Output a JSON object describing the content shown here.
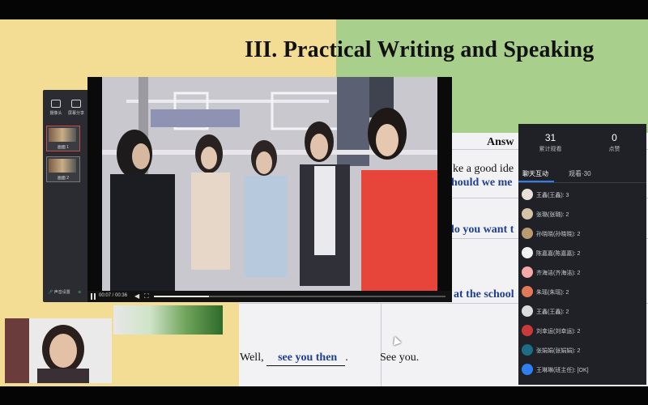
{
  "slide": {
    "title": "III. Practical Writing and Speaking",
    "header_partial": "Answ",
    "line_1": "ke a good ide",
    "answer_1": "hould we me",
    "answer_2": "lo you want t",
    "answer_3": "at the school",
    "bottom_prefix": "Well,",
    "bottom_answer": "see you then",
    "bottom_period": ".",
    "bottom_reply": "See you."
  },
  "toolbar": {
    "camera_label": "摄像头",
    "screen_share_label": "屏幕分享",
    "scene_1_label": "画面 1",
    "scene_2_label": "画面 2",
    "audio_setting_label": "声音设置"
  },
  "video": {
    "time_display": "00:07 / 00:36",
    "progress_fraction": 0.19
  },
  "panel": {
    "viewers_count": "31",
    "viewers_label": "累计观看",
    "likes_count": "0",
    "likes_label": "点赞",
    "tab_chat": "聊天互动",
    "tab_viewers": "观看·30",
    "messages": [
      {
        "text": "王鑫(王鑫): 3",
        "avatar_color": "#e9e1d8"
      },
      {
        "text": "张璐(张璐): 2",
        "avatar_color": "#d6c3a8"
      },
      {
        "text": "孙晓晓(孙晓晓): 2",
        "avatar_color": "#b99b6e"
      },
      {
        "text": "陈嘉嘉(陈嘉嘉): 2",
        "avatar_color": "#f2f2f2"
      },
      {
        "text": "齐海洁(齐海洁): 2",
        "avatar_color": "#f5a9a9"
      },
      {
        "text": "朱瑶(朱瑶): 2",
        "avatar_color": "#e27a5a"
      },
      {
        "text": "王鑫(王鑫): 2",
        "avatar_color": "#dcdcdc"
      },
      {
        "text": "刘幸运(刘幸运): 2",
        "avatar_color": "#c93a3a"
      },
      {
        "text": "张娟娟(张娟娟): 2",
        "avatar_color": "#1e6d86"
      },
      {
        "text": "王琳琳(班主任): [OK]",
        "avatar_color": "#2f7ff0"
      }
    ]
  },
  "colors": {
    "answer_blue": "#1f3f95",
    "accent_blue": "#2f7ff0",
    "panel_bg": "#1f2126"
  }
}
